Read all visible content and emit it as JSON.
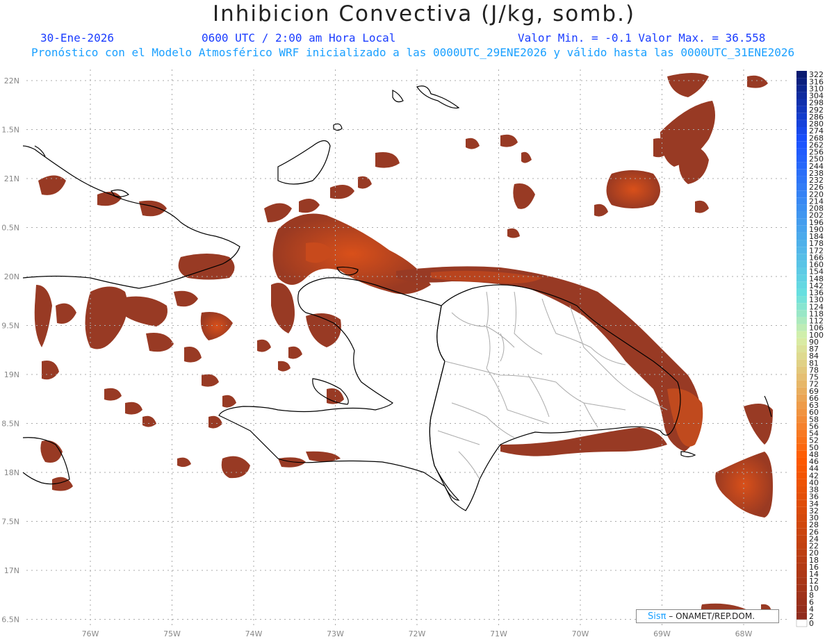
{
  "header": {
    "title": "Inhibicion Convectiva (J/kg, somb.)",
    "date": "30-Ene-2026",
    "time": "0600 UTC / 2:00 am Hora Local",
    "value_range": "Valor Min. = -0.1  Valor Max. = 36.558",
    "forecast_info": "Pronóstico con el Modelo Atmosférico WRF inicializado a las 0000UTC_29ENE2026 y válido hasta las  0000UTC_31ENE2026"
  },
  "axes": {
    "lat_labels": [
      "22N",
      "1.5N",
      "21N",
      "0.5N",
      "20N",
      "9.5N",
      "19N",
      "8.5N",
      "18N",
      "7.5N",
      "17N",
      "6.5N"
    ],
    "lon_labels": [
      "76W",
      "75W",
      "74W",
      "73W",
      "72W",
      "71W",
      "70W",
      "69W",
      "68W"
    ]
  },
  "colorbar": {
    "labels": [
      "322",
      "316",
      "310",
      "304",
      "298",
      "292",
      "286",
      "280",
      "274",
      "268",
      "262",
      "256",
      "250",
      "244",
      "238",
      "232",
      "226",
      "220",
      "214",
      "208",
      "202",
      "196",
      "190",
      "184",
      "178",
      "172",
      "166",
      "160",
      "154",
      "148",
      "142",
      "136",
      "130",
      "124",
      "118",
      "112",
      "106",
      "100",
      "90",
      "87",
      "84",
      "81",
      "78",
      "75",
      "72",
      "69",
      "66",
      "63",
      "60",
      "58",
      "56",
      "54",
      "52",
      "50",
      "48",
      "46",
      "44",
      "42",
      "40",
      "38",
      "36",
      "34",
      "32",
      "30",
      "28",
      "26",
      "24",
      "22",
      "20",
      "18",
      "16",
      "14",
      "12",
      "10",
      "8",
      "6",
      "4",
      "2",
      "0"
    ],
    "colors": {
      "low": "#8b2a1f",
      "orange": "#ff5a00",
      "yellow_green": "#d8f0a8",
      "cyan": "#68e0e0",
      "blue": "#1a50ff",
      "navy": "#0a1a70"
    }
  },
  "credit": {
    "brand": "Sisπ",
    "org": "– ONAMET/REP.DOM."
  },
  "field_color": "#9a3a22",
  "field_highlight": "#d9501a"
}
